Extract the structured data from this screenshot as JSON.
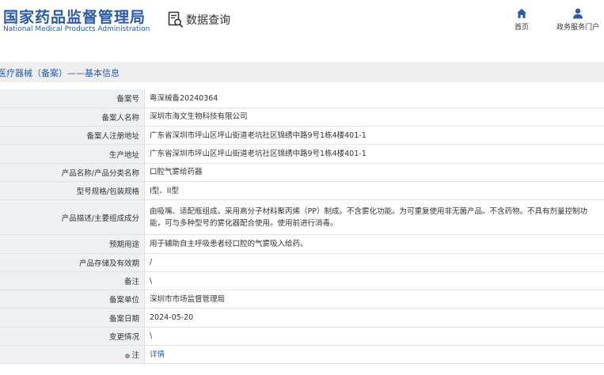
{
  "header": {
    "logo_cn": "国家药品监督管理局",
    "logo_en": "National Medical Products Administration",
    "query_label": "数据查询",
    "nav": [
      {
        "label": "首页",
        "icon": "home-icon"
      },
      {
        "label": "政务服务门户",
        "icon": "user-icon"
      }
    ]
  },
  "breadcrumb": "医疗器械（备案）——基本信息",
  "rows": [
    {
      "label": "备案号",
      "value": "粤深械备20240364"
    },
    {
      "label": "备案人名称",
      "value": "深圳市海文生物科技有限公司"
    },
    {
      "label": "备案人注册地址",
      "value": "广东省深圳市坪山区坪山街道老坑社区锦绣中路9号1栋4楼401-1"
    },
    {
      "label": "生产地址",
      "value": "广东省深圳市坪山区坪山街道老坑社区锦绣中路9号1栋4楼401-1"
    },
    {
      "label": "产品名称/产品分类名称",
      "value": "口腔气雾给药器"
    },
    {
      "label": "型号规格/包装规格",
      "value": "I型、II型"
    },
    {
      "label": "产品描述/主要组成成分",
      "value": "由吸嘴、适配瓶组成。采用高分子材料聚丙烯（PP）制成。不含雾化功能。为可重复使用非无菌产品。不含药物。不具有剂量控制功能，可与多种型号的雾化器配合使用。使用前进行消毒。"
    },
    {
      "label": "预期用途",
      "value": "用于辅助自主呼吸患者经口腔的气雾吸入给药。"
    },
    {
      "label": "产品存储及有效期",
      "value": "/"
    },
    {
      "label": "备注",
      "value": "\\"
    },
    {
      "label": "备案单位",
      "value": "深圳市市场监督管理局"
    },
    {
      "label": "备案日期",
      "value": "2024-05-20"
    },
    {
      "label": "变更情况",
      "value": "\\"
    },
    {
      "label": "注",
      "value": "详情"
    }
  ],
  "colors": {
    "brand": "#2a5aa8",
    "label_bg": "#eef0f4",
    "bar_bg": "#eeeeee"
  }
}
